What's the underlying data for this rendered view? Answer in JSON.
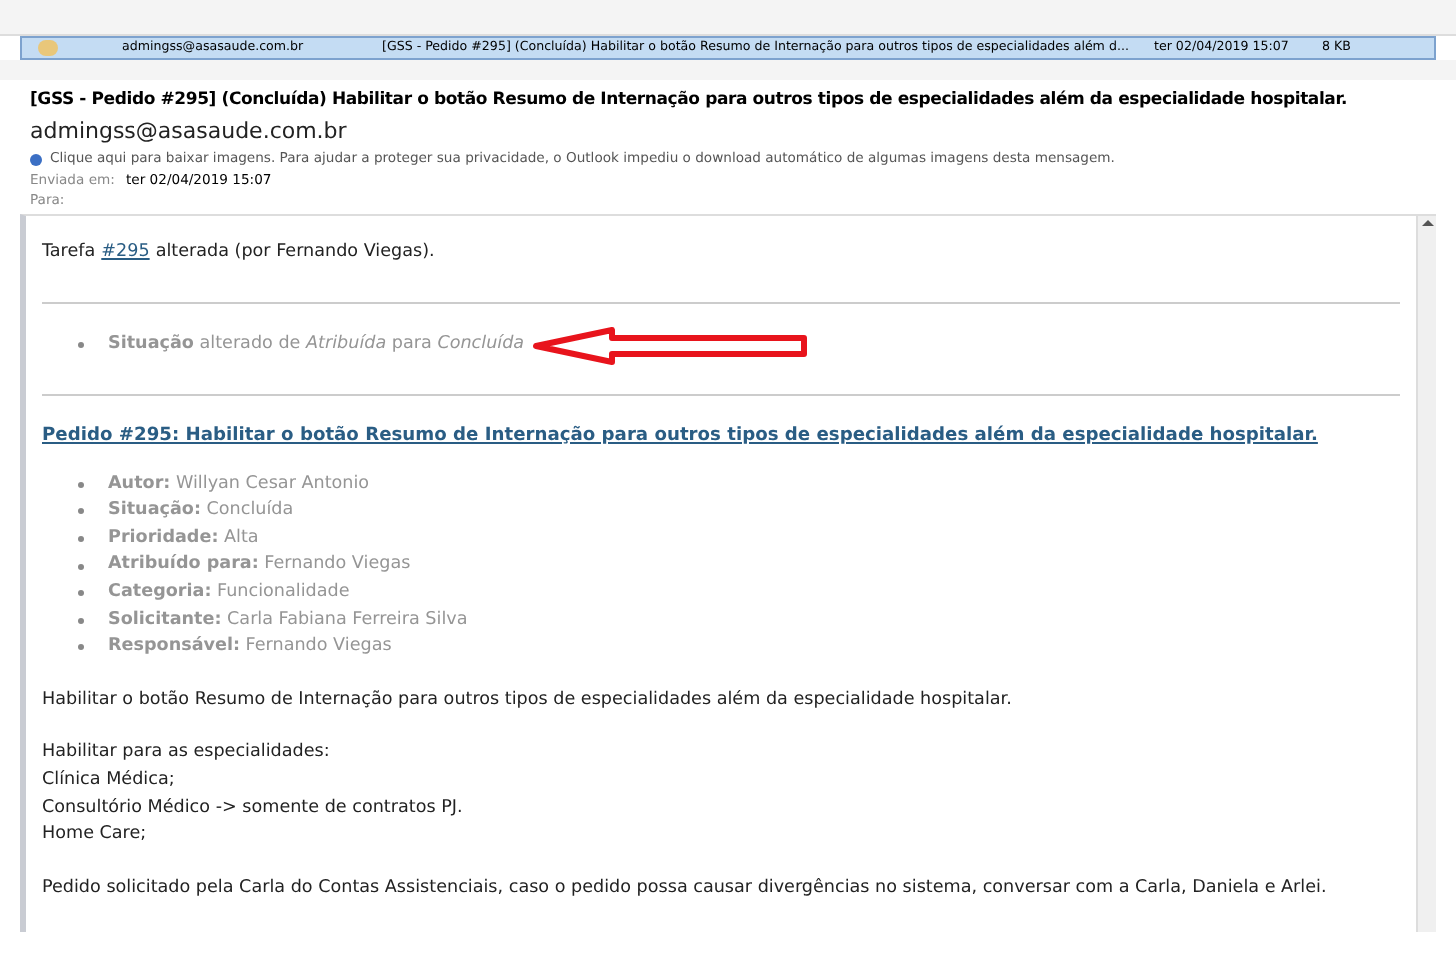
{
  "message_list": {
    "rows": [
      {
        "sender": "admingss@asasaude.com.br",
        "subject": "[GSS - Pedido #295] (Concluída) Habilitar o botão Resumo de Internação para outros tipos de especialidades além d...",
        "date": "ter 02/04/2019 15:07",
        "size": "8 KB",
        "selected": true
      }
    ]
  },
  "header": {
    "subject": "[GSS - Pedido #295] (Concluída) Habilitar o botão Resumo de Internação para outros tipos de especialidades além da especialidade hospitalar.",
    "from": "admingss@asasaude.com.br",
    "info_bar": "Clique aqui para baixar imagens. Para ajudar a proteger sua privacidade, o Outlook impediu o download automático de algumas imagens desta mensagem.",
    "sent_label": "Enviada em:",
    "sent_value": "ter 02/04/2019 15:07",
    "to_label": "Para:"
  },
  "body": {
    "intro": {
      "prefix": "Tarefa",
      "link": "#295",
      "suffix": "alterada (por Fernando Viegas)."
    },
    "changes": [
      "**Situação** alterado de *Atribuída* para *Concluída*"
    ],
    "issue_title": "Pedido #295: Habilitar o botão Resumo de Internação para outros tipos de especialidades além da especialidade hospitalar.",
    "details": [
      "**Autor:** Willyan Cesar Antonio",
      "**Situação:** Concluída",
      "**Prioridade:** Alta",
      "**Atribuído para:** Fernando Viegas",
      "**Categoria:** Funcionalidade",
      "**Solicitante:** Carla Fabiana Ferreira Silva",
      "**Responsável:** Fernando Viegas"
    ],
    "paragraphs": [
      [
        "Habilitar o botão Resumo de Internação para outros tipos de especialidades além da especialidade hospitalar."
      ],
      [
        "Habilitar para as especialidades:",
        "Clínica Médica;",
        "Consultório Médico -> somente de contratos PJ.",
        "Home Care;"
      ],
      [
        "Pedido solicitado pela Carla do Contas Assistenciais, caso o pedido possa causar divergências no sistema, conversar com a Carla, Daniela e Arlei."
      ]
    ]
  }
}
